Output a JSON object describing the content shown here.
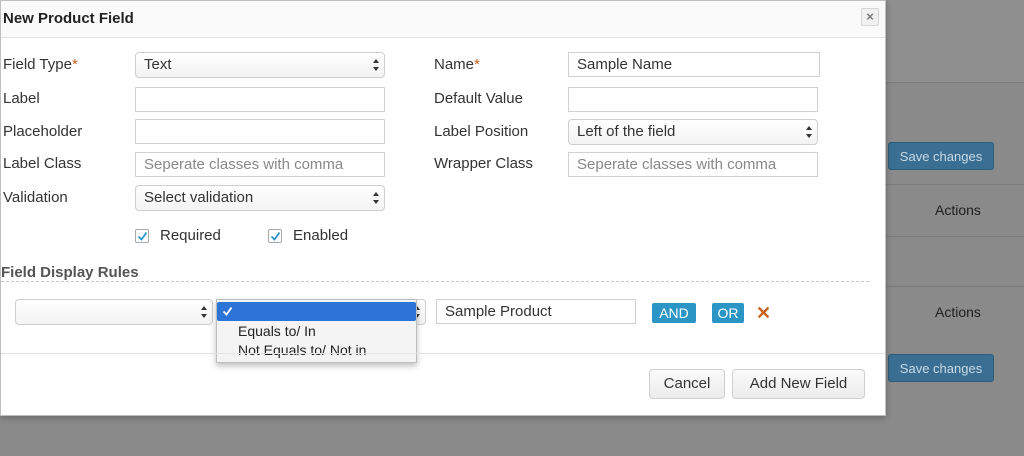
{
  "background": {
    "save_changes_top": "Save changes",
    "actions_1": "Actions",
    "actions_2": "Actions",
    "save_changes_bottom": "Save changes"
  },
  "modal": {
    "title": "New Product Field",
    "close_icon": "close-icon",
    "form": {
      "field_type": {
        "label": "Field Type",
        "required_mark": "*",
        "value": "Text"
      },
      "name": {
        "label": "Name",
        "required_mark": "*",
        "value": "Sample Name"
      },
      "label": {
        "label": "Label",
        "value": ""
      },
      "default_value": {
        "label": "Default Value",
        "value": ""
      },
      "placeholder": {
        "label": "Placeholder",
        "value": ""
      },
      "label_position": {
        "label": "Label Position",
        "value": "Left of the field"
      },
      "label_class": {
        "label": "Label Class",
        "placeholder": "Seperate classes with comma"
      },
      "wrapper_class": {
        "label": "Wrapper Class",
        "placeholder": "Seperate classes with comma"
      },
      "validation": {
        "label": "Validation",
        "value": "Select validation"
      },
      "required_checkbox": {
        "label": "Required",
        "checked": true
      },
      "enabled_checkbox": {
        "label": "Enabled",
        "checked": true
      }
    },
    "display_rules": {
      "title": "Field Display Rules",
      "field_select_value": "",
      "condition_select_value": "",
      "dropdown_options": [
        "Equals to/ In",
        "Not Equals to/ Not in"
      ],
      "value_input": "Sample Product",
      "and_label": "AND",
      "or_label": "OR",
      "remove_icon": "x-icon"
    },
    "footer": {
      "cancel_label": "Cancel",
      "add_label": "Add New Field"
    }
  },
  "colors": {
    "accent_blue": "#2b96c6",
    "required_orange": "#c7611c",
    "dropdown_highlight": "#2c75d6"
  }
}
